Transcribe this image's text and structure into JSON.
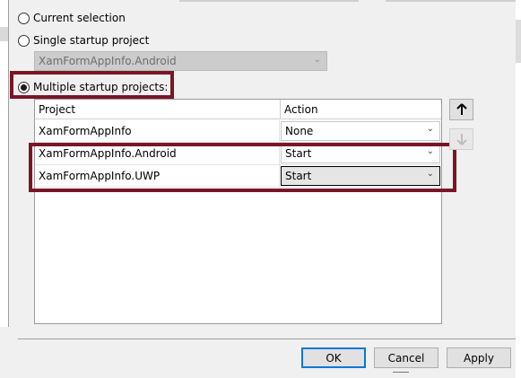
{
  "startup_options": {
    "current_selection_label": "Current selection",
    "single_startup_label": "Single startup project",
    "single_startup_value": "XamFormAppInfo.Android",
    "multiple_startup_label": "Multiple startup projects:",
    "selected_option": "multiple"
  },
  "grid": {
    "columns": [
      "Project",
      "Action"
    ],
    "rows": [
      {
        "project": "XamFormAppInfo",
        "action": "None"
      },
      {
        "project": "XamFormAppInfo.Android",
        "action": "Start"
      },
      {
        "project": "XamFormAppInfo.UWP",
        "action": "Start"
      }
    ]
  },
  "move_buttons": {
    "up_icon": "arrow-up-icon",
    "down_icon": "arrow-down-icon"
  },
  "dialog_buttons": {
    "ok_label": "OK",
    "cancel_label": "Cancel",
    "apply_label": "Apply"
  },
  "colors": {
    "highlight": "#7b1526",
    "default_button_border": "#0078d7",
    "window_background": "#f0f0f0"
  }
}
